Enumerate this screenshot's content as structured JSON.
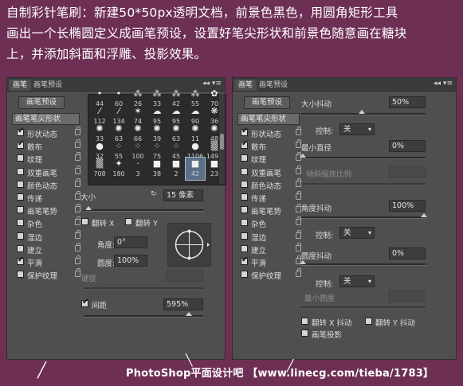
{
  "instructions": {
    "line1": "自制彩针笔刷：新建50*50px透明文档，前景色黑色，用圆角矩形工具",
    "line2": "画出一个长椭圆定义成画笔预设，设置好笔尖形状和前景色随意画在糖块",
    "line3": "上，并添加斜面和浮雕、投影效果。"
  },
  "left_panel": {
    "tabs": [
      "画笔",
      "画笔预设"
    ],
    "panel_controls": "◂◂ ▾≡",
    "preset_button": "画笔预设",
    "tip_header": "画笔笔尖形状",
    "options": [
      {
        "label": "形状动态",
        "checked": true
      },
      {
        "label": "散布",
        "checked": true
      },
      {
        "label": "纹理",
        "checked": false
      },
      {
        "label": "双重画笔",
        "checked": false
      },
      {
        "label": "颜色动态",
        "checked": false
      },
      {
        "label": "传递",
        "checked": false
      },
      {
        "label": "画笔笔势",
        "checked": false
      },
      {
        "label": "杂色",
        "checked": false
      },
      {
        "label": "湿边",
        "checked": false
      },
      {
        "label": "建立",
        "checked": false
      },
      {
        "label": "平滑",
        "checked": true
      },
      {
        "label": "保护纹理",
        "checked": false
      }
    ],
    "brush_grid": [
      {
        "icon": "circle-small-icon",
        "glyph": "•",
        "size": "44"
      },
      {
        "icon": "circle-small-icon",
        "glyph": "•",
        "size": "60"
      },
      {
        "icon": "grass-icon",
        "glyph": "⁂",
        "size": "26"
      },
      {
        "icon": "grass-icon",
        "glyph": "⁂",
        "size": "33"
      },
      {
        "icon": "grass-icon",
        "glyph": "⁂",
        "size": "42"
      },
      {
        "icon": "grass-icon",
        "glyph": "⁂",
        "size": "55"
      },
      {
        "icon": "leaf-icon",
        "glyph": "✿",
        "size": "70"
      },
      {
        "icon": "stroke-icon",
        "glyph": "⁄",
        "size": "112"
      },
      {
        "icon": "stroke-icon",
        "glyph": "⁄",
        "size": "134"
      },
      {
        "icon": "star-icon",
        "glyph": "✶",
        "size": "74"
      },
      {
        "icon": "cloud-icon",
        "glyph": "☁",
        "size": "95"
      },
      {
        "icon": "cloud-icon",
        "glyph": "☁",
        "size": "95"
      },
      {
        "icon": "cloud-icon",
        "glyph": "☁",
        "size": "90"
      },
      {
        "icon": "blob-icon",
        "glyph": "❋",
        "size": "36"
      },
      {
        "icon": "splatter-icon",
        "glyph": "✺",
        "size": "33"
      },
      {
        "icon": "splatter-icon",
        "glyph": "✺",
        "size": "63"
      },
      {
        "icon": "splatter-icon",
        "glyph": "✺",
        "size": "66"
      },
      {
        "icon": "splatter-icon",
        "glyph": "✺",
        "size": "39"
      },
      {
        "icon": "splatter-icon",
        "glyph": "✺",
        "size": "63"
      },
      {
        "icon": "splatter-icon",
        "glyph": "✺",
        "size": "11"
      },
      {
        "icon": "splatter-icon",
        "glyph": "✺",
        "size": "48"
      },
      {
        "icon": "soft-round-icon",
        "glyph": "●",
        "size": "32"
      },
      {
        "icon": "dots-icon",
        "glyph": "⁘",
        "size": "55"
      },
      {
        "icon": "dots-icon",
        "glyph": "⁘",
        "size": "100"
      },
      {
        "icon": "dots-icon",
        "glyph": "⁘",
        "size": "75"
      },
      {
        "icon": "dots-icon",
        "glyph": "⁘",
        "size": "45"
      },
      {
        "icon": "hard-round-icon",
        "glyph": "●",
        "size": "1106"
      },
      {
        "icon": "texture-icon",
        "glyph": "▒",
        "size": "1499"
      },
      {
        "icon": "texture-icon",
        "glyph": "▒",
        "size": "708"
      },
      {
        "icon": "spark-icon",
        "glyph": "✦",
        "size": "180"
      },
      {
        "icon": "dot-icon",
        "glyph": "·",
        "size": "3"
      },
      {
        "icon": "square-icon",
        "glyph": "■",
        "size": "38"
      },
      {
        "icon": "square-icon",
        "glyph": "■",
        "size": "2"
      },
      {
        "icon": "custom-brush-icon",
        "glyph": "■",
        "size": "42"
      },
      {
        "icon": "custom-brush-icon",
        "glyph": "■",
        "size": "23"
      }
    ],
    "size_label": "大小",
    "size_value": "15 像素",
    "flip_x": "翻转 X",
    "flip_y": "翻转 Y",
    "angle_label": "角度:",
    "angle_value": "0°",
    "roundness_label": "圆度:",
    "roundness_value": "100%",
    "hardness_label": "硬度",
    "spacing_label": "间距",
    "spacing_checked": true,
    "spacing_value": "595%"
  },
  "right_panel": {
    "tabs": [
      "画笔",
      "画笔预设"
    ],
    "panel_controls": "◂◂ ▾≡",
    "preset_button": "画笔预设",
    "tip_header": "画笔笔尖形状",
    "options": [
      {
        "label": "形状动态",
        "checked": true
      },
      {
        "label": "散布",
        "checked": true
      },
      {
        "label": "纹理",
        "checked": false
      },
      {
        "label": "双重画笔",
        "checked": false
      },
      {
        "label": "颜色动态",
        "checked": false
      },
      {
        "label": "传递",
        "checked": false
      },
      {
        "label": "画笔笔势",
        "checked": false
      },
      {
        "label": "杂色",
        "checked": false
      },
      {
        "label": "湿边",
        "checked": false
      },
      {
        "label": "建立",
        "checked": false
      },
      {
        "label": "平滑",
        "checked": true
      },
      {
        "label": "保护纹理",
        "checked": false
      }
    ],
    "size_jitter_label": "大小抖动",
    "size_jitter_value": "50%",
    "control_label": "控制:",
    "control_value_1": "关",
    "min_diameter_label": "最小直径",
    "min_diameter_value": "0%",
    "tilt_scale_label": "倾斜缩放比例",
    "angle_jitter_label": "角度抖动",
    "angle_jitter_value": "100%",
    "control_value_2": "关",
    "roundness_jitter_label": "圆度抖动",
    "roundness_jitter_value": "0%",
    "control_value_3": "关",
    "min_roundness_label": "最小圆度",
    "flip_x_jitter": "翻转 X 抖动",
    "flip_y_jitter": "翻转 Y 抖动",
    "brush_projection": "画笔投影"
  },
  "watermark": "PhotoShop平面设计吧 【www.linecg.com/tieba/1783】"
}
